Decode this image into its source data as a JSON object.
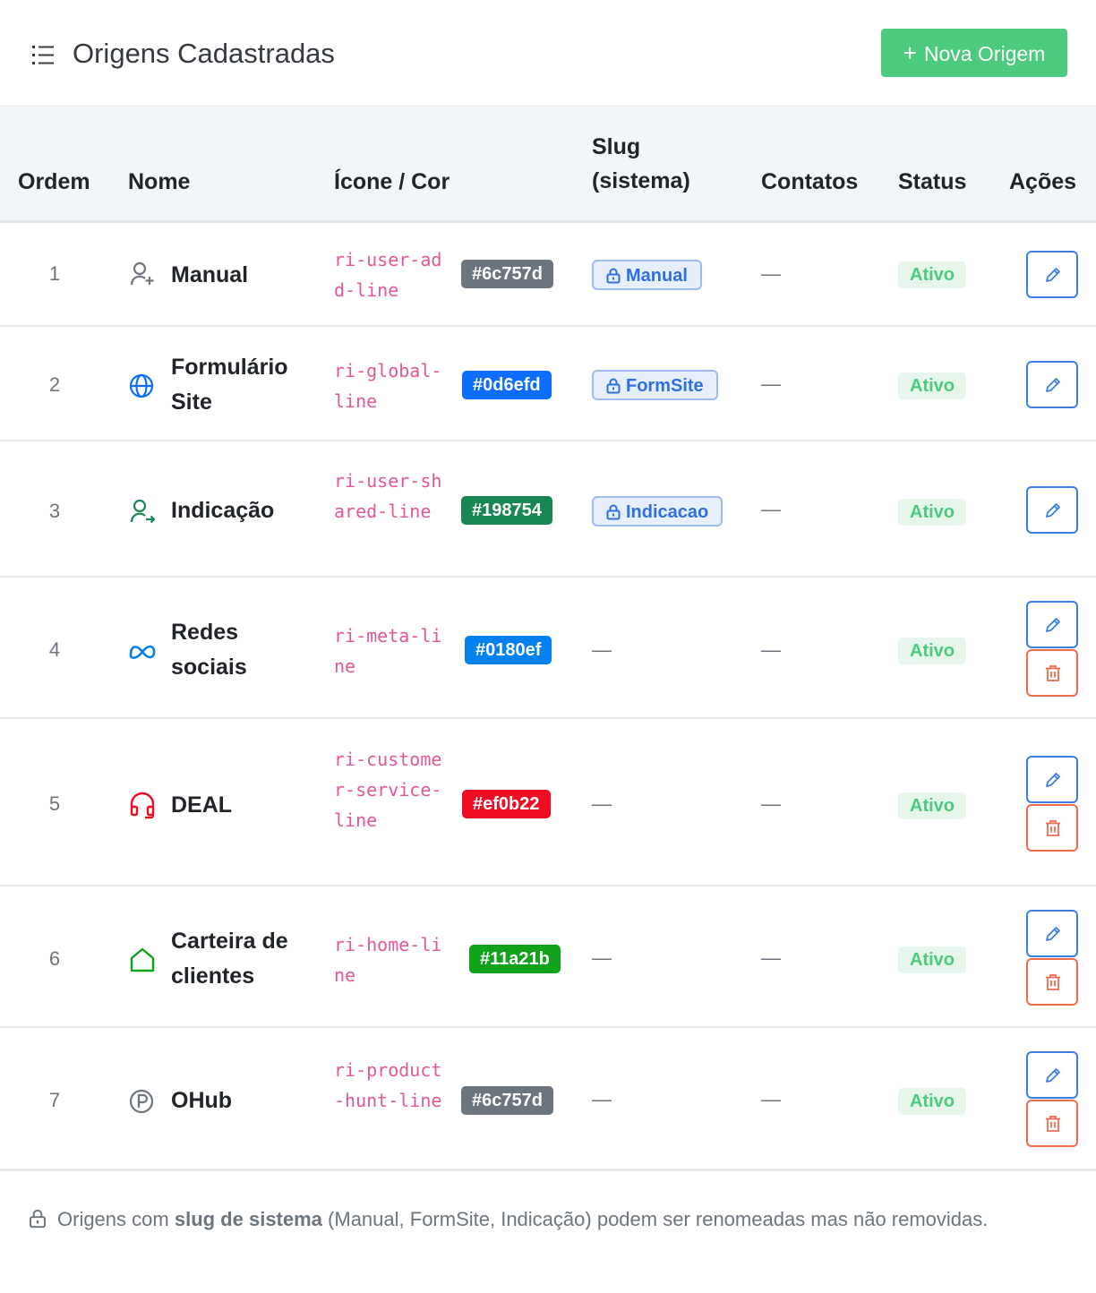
{
  "header": {
    "title": "Origens Cadastradas",
    "new_button": "Nova Origem",
    "new_button_plus": "+"
  },
  "columns": {
    "ordem": "Ordem",
    "nome": "Nome",
    "icone_cor": "Ícone / Cor",
    "slug_line1": "Slug",
    "slug_line2": "(sistema)",
    "contatos": "Contatos",
    "status": "Status",
    "acoes": "Ações"
  },
  "rows": [
    {
      "ordem": "1",
      "nome": "Manual",
      "icon_class": "ri-user-add-line",
      "icon": "user-add-icon",
      "color": "#6c757d",
      "slug": "Manual",
      "contatos": "—",
      "status": "Ativo",
      "deletable": false
    },
    {
      "ordem": "2",
      "nome": "Formulário Site",
      "icon_class": "ri-global-line",
      "icon": "globe-icon",
      "color": "#0d6efd",
      "slug": "FormSite",
      "contatos": "—",
      "status": "Ativo",
      "deletable": false
    },
    {
      "ordem": "3",
      "nome": "Indicação",
      "icon_class": "ri-user-shared-line",
      "icon": "user-shared-icon",
      "color": "#198754",
      "slug": "Indicacao",
      "contatos": "—",
      "status": "Ativo",
      "deletable": false
    },
    {
      "ordem": "4",
      "nome": "Redes sociais",
      "icon_class": "ri-meta-line",
      "icon": "meta-icon",
      "color": "#0180ef",
      "slug": "—",
      "contatos": "—",
      "status": "Ativo",
      "deletable": true
    },
    {
      "ordem": "5",
      "nome": "DEAL",
      "icon_class": "ri-customer-service-line",
      "icon": "headset-icon",
      "color": "#ef0b22",
      "slug": "—",
      "contatos": "—",
      "status": "Ativo",
      "deletable": true
    },
    {
      "ordem": "6",
      "nome": "Carteira de clientes",
      "icon_class": "ri-home-line",
      "icon": "home-icon",
      "color": "#11a21b",
      "slug": "—",
      "contatos": "—",
      "status": "Ativo",
      "deletable": true
    },
    {
      "ordem": "7",
      "nome": "OHub",
      "icon_class": "ri-product-hunt-line",
      "icon": "product-hunt-icon",
      "color": "#6c757d",
      "slug": "—",
      "contatos": "—",
      "status": "Ativo",
      "deletable": true
    }
  ],
  "footer": {
    "prefix": "Origens com",
    "bold": "slug de sistema",
    "suffix": "(Manual, FormSite, Indicação) podem ser renomeadas mas não removidas."
  },
  "colors": {
    "accent_green": "#4ccb7e",
    "edit_blue": "#3a7ee6",
    "delete_red": "#ee6b4d",
    "code_pink": "#e1579a"
  }
}
